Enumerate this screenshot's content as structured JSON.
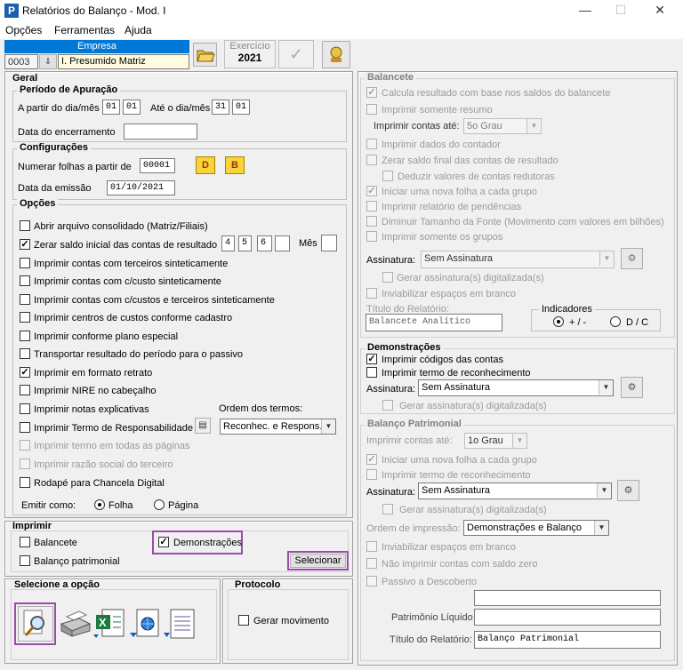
{
  "window": {
    "title": "Relatórios do Balanço - Mod. I",
    "app_icon": "P"
  },
  "menu": [
    "Opções",
    "Ferramentas",
    "Ajuda"
  ],
  "empresa": {
    "header": "Empresa",
    "code": "0003",
    "name": "I. Presumido Matriz"
  },
  "exercicio": {
    "label": "Exercício",
    "value": "2021"
  },
  "geral": {
    "title": "Geral",
    "periodo": {
      "title": "Período de Apuração",
      "from_label": "A partir do dia/mês",
      "from_day": "01",
      "from_month": "01",
      "to_label": "Até o dia/mês",
      "to_day": "31",
      "to_month": "01",
      "close_label": "Data do encerramento",
      "close_value": ""
    },
    "config": {
      "title": "Configurações",
      "numerar_label": "Numerar folhas a partir de",
      "numerar_value": "00001",
      "btn_d": "D",
      "btn_b": "B",
      "emissao_label": "Data da emissão",
      "emissao_value": "01/10/2021"
    },
    "opcoes": {
      "title": "Opções",
      "items": [
        {
          "label": "Abrir arquivo consolidado (Matriz/Filiais)",
          "checked": false,
          "enabled": true
        },
        {
          "label": "Zerar saldo inicial das contas de resultado",
          "checked": true,
          "enabled": true
        },
        {
          "label": "Imprimir contas com terceiros sinteticamente",
          "checked": false,
          "enabled": true
        },
        {
          "label": "Imprimir contas com c/custo sinteticamente",
          "checked": false,
          "enabled": true
        },
        {
          "label": "Imprimir contas com c/custos e terceiros sinteticamente",
          "checked": false,
          "enabled": true
        },
        {
          "label": "Imprimir centros de custos conforme cadastro",
          "checked": false,
          "enabled": true
        },
        {
          "label": "Imprimir conforme plano especial",
          "checked": false,
          "enabled": true
        },
        {
          "label": "Transportar resultado do período para o passivo",
          "checked": false,
          "enabled": true
        },
        {
          "label": "Imprimir em formato retrato",
          "checked": true,
          "enabled": true
        },
        {
          "label": "Imprimir NIRE no cabeçalho",
          "checked": false,
          "enabled": true
        },
        {
          "label": "Imprimir notas explicativas",
          "checked": false,
          "enabled": true
        },
        {
          "label": "Imprimir Termo de Responsabilidade",
          "checked": false,
          "enabled": true
        },
        {
          "label": "Imprimir termo em todas as páginas",
          "checked": false,
          "enabled": false
        },
        {
          "label": "Imprimir razão social do terceiro",
          "checked": false,
          "enabled": false
        },
        {
          "label": "Rodapé para Chancela Digital",
          "checked": false,
          "enabled": true
        }
      ],
      "zerar_values": [
        "4",
        "5",
        "6",
        ""
      ],
      "mes_label": "Mês",
      "mes_value": "",
      "ordem_label": "Ordem dos termos:",
      "ordem_value": "Reconhec. e Respons."
    },
    "emitir": {
      "label": "Emitir como:",
      "opt1": "Folha",
      "opt2": "Página"
    }
  },
  "imprimir": {
    "title": "Imprimir",
    "balancete": "Balancete",
    "balanco": "Balanço patrimonial",
    "demonstracoes": "Demonstrações",
    "selecionar": "Selecionar"
  },
  "selecione": {
    "title": "Selecione a opção"
  },
  "protocolo": {
    "title": "Protocolo",
    "gerar": "Gerar movimento"
  },
  "balancete": {
    "title": "Balancete",
    "items": [
      "Calcula resultado com base nos saldos do balancete",
      "Imprimir somente resumo"
    ],
    "contas_label": "Imprimir contas até:",
    "contas_value": "5o Grau",
    "items2": [
      "Imprimir dados do contador",
      "Zerar saldo final das contas de resultado",
      "Deduzir valores de contas redutoras",
      "Iniciar uma nova folha a cada grupo",
      "Imprimir relatório de pendências",
      "Diminuir Tamanho da Fonte (Movimento com valores em bilhões)",
      "Imprimir somente os grupos"
    ],
    "assinatura_label": "Assinatura:",
    "assinatura_value": "Sem Assinatura",
    "gerar_assin": "Gerar assinatura(s) digitalizada(s)",
    "inviab": "Inviabilizar espaços em branco",
    "titulo_label": "Título do Relatório:",
    "titulo_value": "Balancete Analítico",
    "indicadores": {
      "title": "Indicadores",
      "opt1": "+ / -",
      "opt2": "D / C"
    }
  },
  "demonstracoes": {
    "title": "Demonstrações",
    "cod": "Imprimir códigos das contas",
    "termo": "Imprimir termo de reconhecimento",
    "assinatura_label": "Assinatura:",
    "assinatura_value": "Sem Assinatura",
    "gerar": "Gerar assinatura(s) digitalizada(s)"
  },
  "balanco": {
    "title": "Balanço Patrimonial",
    "contas_label": "Imprimir contas até:",
    "contas_value": "1o Grau",
    "nova": "Iniciar uma nova folha a cada grupo",
    "termo": "Imprimir termo de reconhecimento",
    "assinatura_label": "Assinatura:",
    "assinatura_value": "Sem Assinatura",
    "gerar": "Gerar assinatura(s) digitalizada(s)",
    "ordem_label": "Ordem de impressão:",
    "ordem_value": "Demonstrações e Balanço",
    "inviab": "Inviabilizar espaços em branco",
    "nao_impr": "Não imprimir contas com saldo zero",
    "passivo": "Passivo a Descoberto",
    "pl_label": "Patrimônio Líquido",
    "titulo_label": "Título do Relatório:",
    "titulo_value": "Balanço Patrimonial"
  }
}
